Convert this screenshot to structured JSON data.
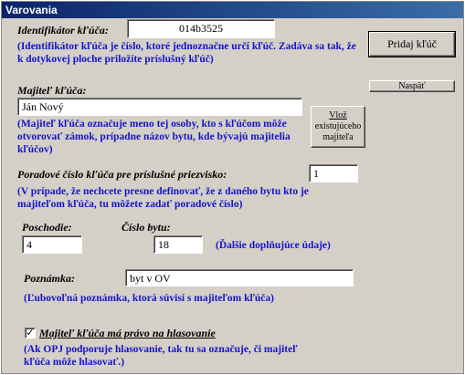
{
  "window": {
    "title": "Varovania"
  },
  "key_id": {
    "label": "Identifikátor kľúča:",
    "value": "014b3525",
    "hint": "(Identifikátor kľúča je číslo, ktoré jednoznačne určí kľúč. Zadáva sa tak, že k dotykovej ploche priložíte príslušný kľúč)"
  },
  "owner": {
    "label": "Majiteľ kľúča:",
    "value": "Ján Nový",
    "hint": "(Majiteľ kľúča označuje meno tej osoby, kto s kľúčom môže otvorovať zámok, prípadne názov bytu, kde bývajú majitelia kľúčov)"
  },
  "sequence": {
    "label": "Poradové číslo kľúča pre príslušné priezvisko:",
    "value": "1",
    "hint": "(V prípade, že nechcete presne definovať, že z daného bytu kto je majiteľom kľúča, tu môžete zadať poradové číslo)"
  },
  "floor": {
    "label": "Poschodie:",
    "value": "4"
  },
  "flat": {
    "label": "Číslo bytu:",
    "value": "18"
  },
  "extra_hint": "(Ďalšie doplňujúce údaje)",
  "note": {
    "label": "Poznámka:",
    "value": "byt v OV",
    "hint": "(Ľubovoľná poznámka, ktorá súvisí s majiteľom kľúča)"
  },
  "voting": {
    "label": "Majiteľ kľúča má právo na hlasovanie",
    "checked": true,
    "check_glyph": "✓",
    "hint": "(Ak OPJ podporuje hlasovanie, tak tu sa označuje, či majiteľ kľúča môže hlasovať.)"
  },
  "buttons": {
    "add": "Pridaj kľúč",
    "back": "Naspäť",
    "insert_line1": "Vlož",
    "insert_line2": "existujúceho",
    "insert_line3": "majiteľa"
  }
}
